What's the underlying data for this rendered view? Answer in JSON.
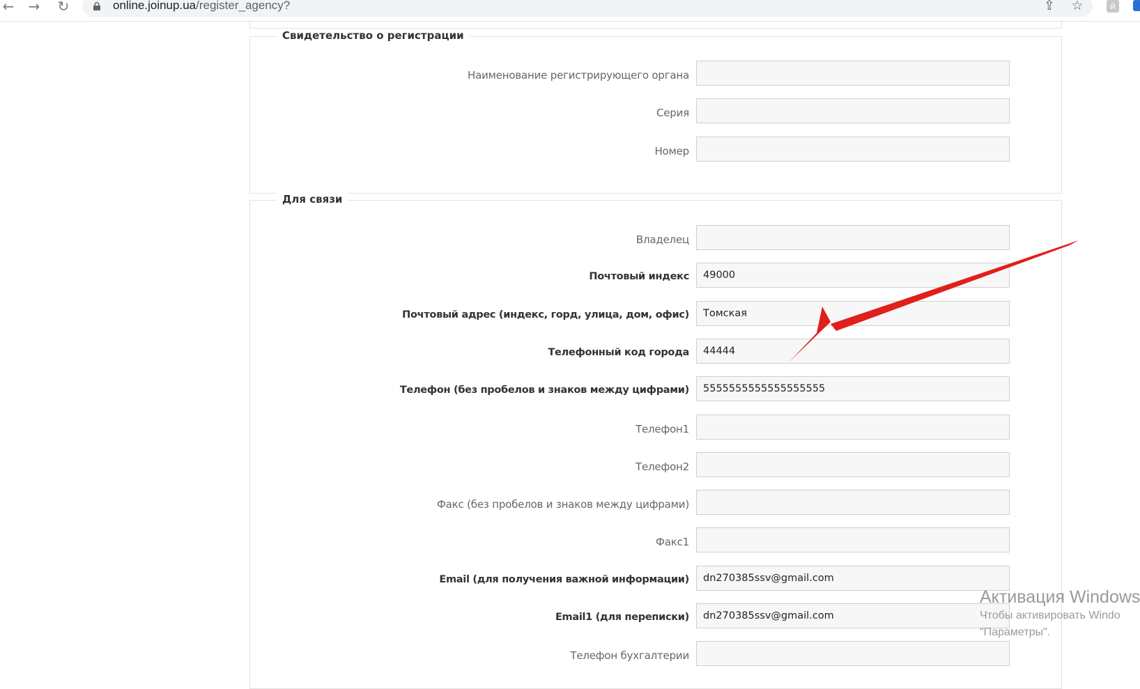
{
  "browser": {
    "url_host": "online.joinup.ua",
    "url_path": "/register_agency?",
    "back_icon": "←",
    "forward_icon": "→",
    "reload_icon": "↻",
    "share_icon": "⇪",
    "star_icon": "☆",
    "extension_letter": "й"
  },
  "sections": {
    "registration": {
      "legend": "Свидетельство о регистрации",
      "fields": [
        {
          "label": "Наименование регистрирующего органа",
          "value": "",
          "required": false
        },
        {
          "label": "Серия",
          "value": "",
          "required": false
        },
        {
          "label": "Номер",
          "value": "",
          "required": false
        }
      ]
    },
    "contact": {
      "legend": "Для связи",
      "fields": [
        {
          "label": "Владелец",
          "value": "",
          "required": false
        },
        {
          "label": "Почтовый индекс",
          "value": "49000",
          "required": true
        },
        {
          "label": "Почтовый адрес (индекс, горд, улица, дом, офис)",
          "value": "Томская",
          "required": true
        },
        {
          "label": "Телефонный код города",
          "value": "44444",
          "required": true
        },
        {
          "label": "Телефон (без пробелов и знаков между цифрами)",
          "value": "5555555555555555555",
          "required": true
        },
        {
          "label": "Телефон1",
          "value": "",
          "required": false
        },
        {
          "label": "Телефон2",
          "value": "",
          "required": false
        },
        {
          "label": "Факс (без пробелов и знаков между цифрами)",
          "value": "",
          "required": false
        },
        {
          "label": "Факс1",
          "value": "",
          "required": false
        },
        {
          "label": "Email (для получения важной информации)",
          "value": "dn270385ssv@gmail.com",
          "required": true
        },
        {
          "label": "Email1 (для переписки)",
          "value": "dn270385ssv@gmail.com",
          "required": true
        },
        {
          "label": "Телефон бухгалтерии",
          "value": "",
          "required": false
        }
      ]
    }
  },
  "watermark": {
    "line1": "Активация Windows",
    "line2": "Чтобы активировать Windo",
    "line3": "\"Параметры\"."
  },
  "colors": {
    "arrow": "#e0201b",
    "input_bg": "#f7f7f7",
    "input_border": "#cfcfcf",
    "fieldset_border": "#e2e2e2"
  }
}
